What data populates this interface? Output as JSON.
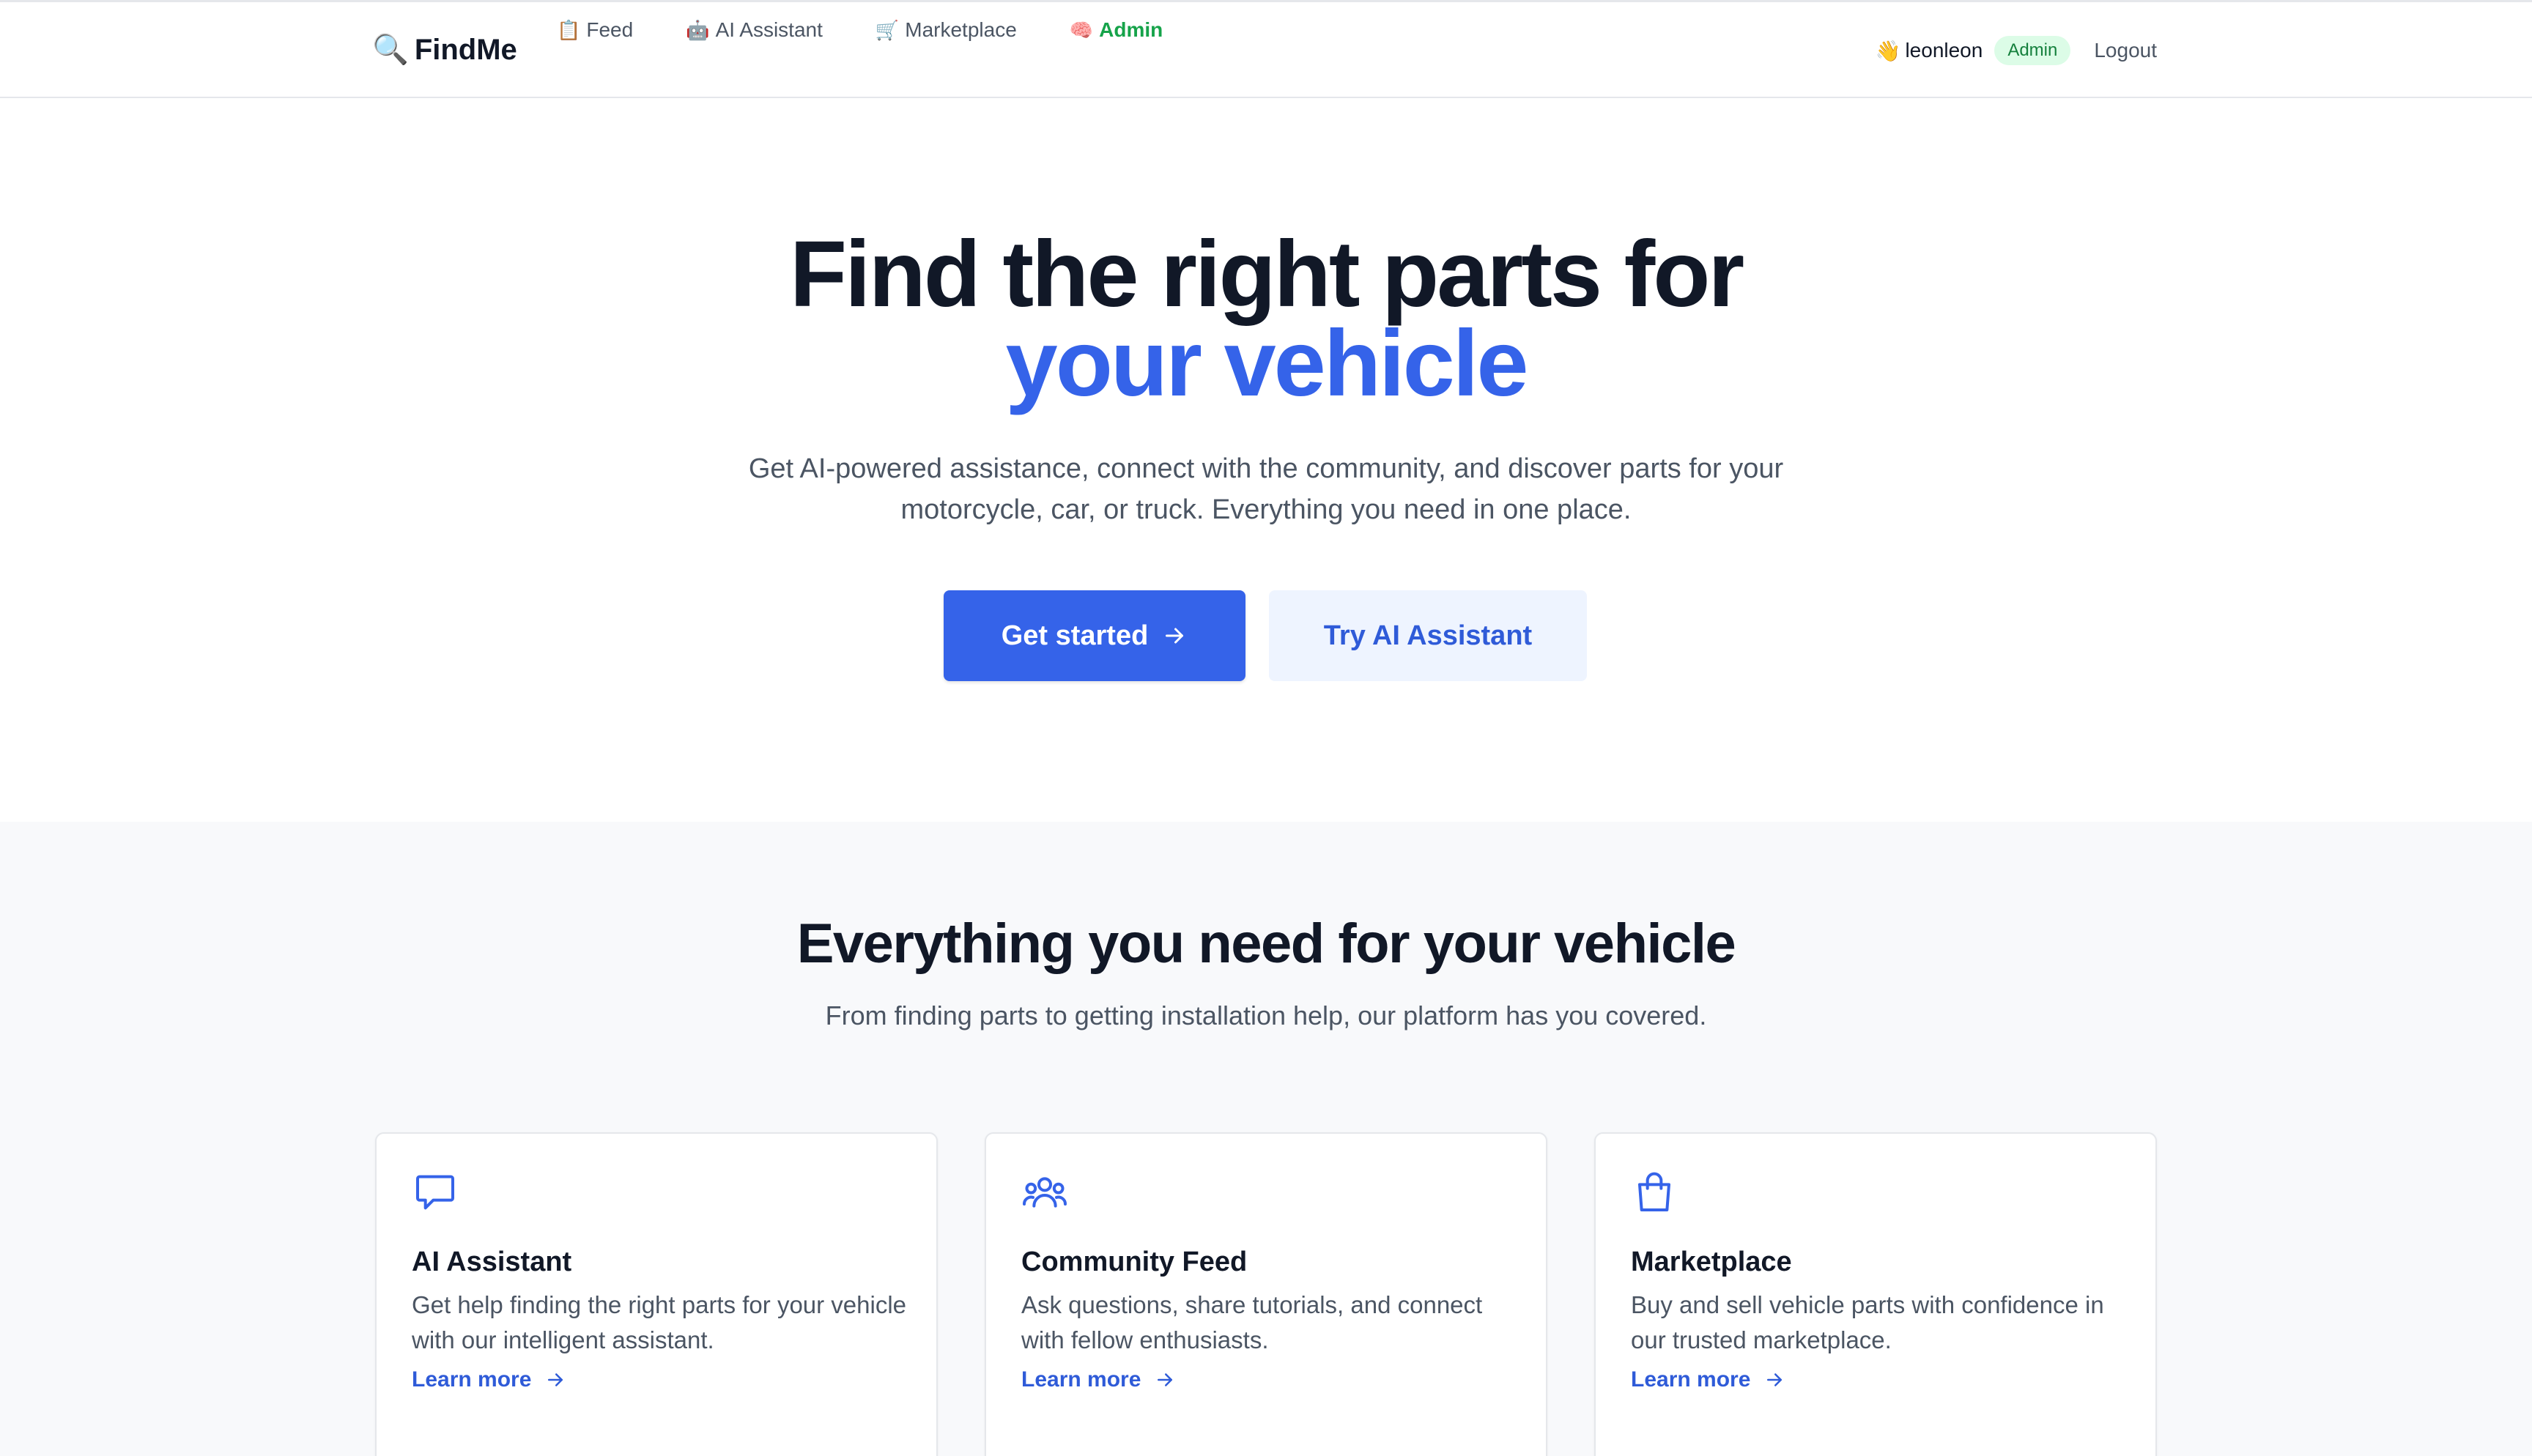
{
  "header": {
    "logo_icon": "🔍",
    "logo_text": "FindMe",
    "nav": [
      {
        "icon": "📋",
        "label": "Feed"
      },
      {
        "icon": "🤖",
        "label": "AI Assistant"
      },
      {
        "icon": "🛒",
        "label": "Marketplace"
      },
      {
        "icon": "🧠",
        "label": "Admin"
      }
    ],
    "user_icon": "👋",
    "user_name": "leonleon",
    "role_badge": "Admin",
    "logout_label": "Logout"
  },
  "hero": {
    "title_line1": "Find the right parts for",
    "title_line2": "your vehicle",
    "subtitle": "Get AI-powered assistance, connect with the community, and discover parts for your motorcycle, car, or truck. Everything you need in one place.",
    "primary_button": "Get started",
    "secondary_button": "Try AI Assistant"
  },
  "features": {
    "title": "Everything you need for your vehicle",
    "subtitle": "From finding parts to getting installation help, our platform has you covered.",
    "cards": [
      {
        "icon": "chat-bubble-icon",
        "title": "AI Assistant",
        "description": "Get help finding the right parts for your vehicle with our intelligent assistant.",
        "link": "Learn more"
      },
      {
        "icon": "users-group-icon",
        "title": "Community Feed",
        "description": "Ask questions, share tutorials, and connect with fellow enthusiasts.",
        "link": "Learn more"
      },
      {
        "icon": "shopping-bag-icon",
        "title": "Marketplace",
        "description": "Buy and sell vehicle parts with confidence in our trusted marketplace.",
        "link": "Learn more"
      }
    ]
  },
  "colors": {
    "primary": "#3563e9",
    "admin_green": "#16a34a",
    "text_dark": "#111827",
    "text_muted": "#4b5563",
    "section_bg": "#f8f9fb"
  }
}
